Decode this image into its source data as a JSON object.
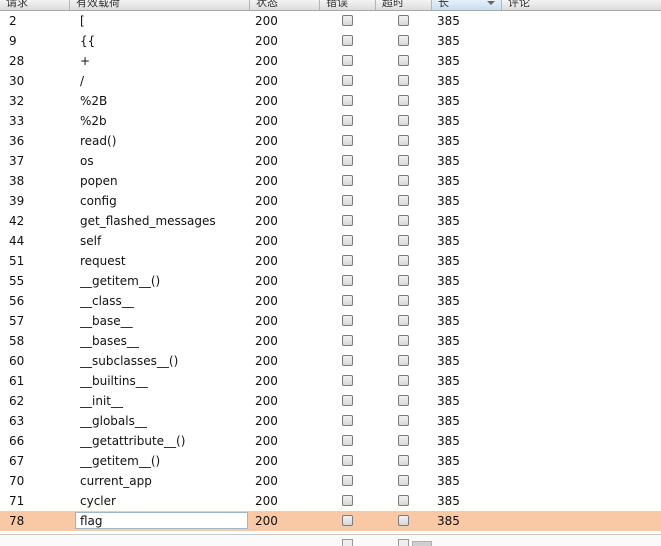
{
  "columns": {
    "request": "请求",
    "payload": "有效载荷",
    "status": "状态",
    "error": "错误",
    "timeout": "超时",
    "length": "长",
    "comment": "评论"
  },
  "rows": [
    {
      "request": "2",
      "payload": "[",
      "status": "200",
      "length": "385"
    },
    {
      "request": "9",
      "payload": "{{",
      "status": "200",
      "length": "385"
    },
    {
      "request": "28",
      "payload": "+",
      "status": "200",
      "length": "385"
    },
    {
      "request": "30",
      "payload": "/",
      "status": "200",
      "length": "385"
    },
    {
      "request": "32",
      "payload": "%2B",
      "status": "200",
      "length": "385"
    },
    {
      "request": "33",
      "payload": "%2b",
      "status": "200",
      "length": "385"
    },
    {
      "request": "36",
      "payload": "read()",
      "status": "200",
      "length": "385"
    },
    {
      "request": "37",
      "payload": "os",
      "status": "200",
      "length": "385"
    },
    {
      "request": "38",
      "payload": "popen",
      "status": "200",
      "length": "385"
    },
    {
      "request": "39",
      "payload": "config",
      "status": "200",
      "length": "385"
    },
    {
      "request": "42",
      "payload": "get_flashed_messages",
      "status": "200",
      "length": "385"
    },
    {
      "request": "44",
      "payload": "self",
      "status": "200",
      "length": "385"
    },
    {
      "request": "51",
      "payload": "request",
      "status": "200",
      "length": "385"
    },
    {
      "request": "55",
      "payload": "__getitem__()",
      "status": "200",
      "length": "385"
    },
    {
      "request": "56",
      "payload": "__class__",
      "status": "200",
      "length": "385"
    },
    {
      "request": "57",
      "payload": "__base__",
      "status": "200",
      "length": "385"
    },
    {
      "request": "58",
      "payload": "__bases__",
      "status": "200",
      "length": "385"
    },
    {
      "request": "60",
      "payload": "__subclasses__()",
      "status": "200",
      "length": "385"
    },
    {
      "request": "61",
      "payload": "__builtins__",
      "status": "200",
      "length": "385"
    },
    {
      "request": "62",
      "payload": "__init__",
      "status": "200",
      "length": "385"
    },
    {
      "request": "63",
      "payload": "__globals__",
      "status": "200",
      "length": "385"
    },
    {
      "request": "66",
      "payload": "__getattribute__()",
      "status": "200",
      "length": "385"
    },
    {
      "request": "67",
      "payload": "__getitem__()",
      "status": "200",
      "length": "385"
    },
    {
      "request": "70",
      "payload": "current_app",
      "status": "200",
      "length": "385"
    },
    {
      "request": "71",
      "payload": "cycler",
      "status": "200",
      "length": "385"
    },
    {
      "request": "78",
      "payload": "flag",
      "status": "200",
      "length": "385",
      "selected": true
    }
  ],
  "colors": {
    "selected_row": "#f8c9a4",
    "sorted_header": "#c9dcef"
  }
}
